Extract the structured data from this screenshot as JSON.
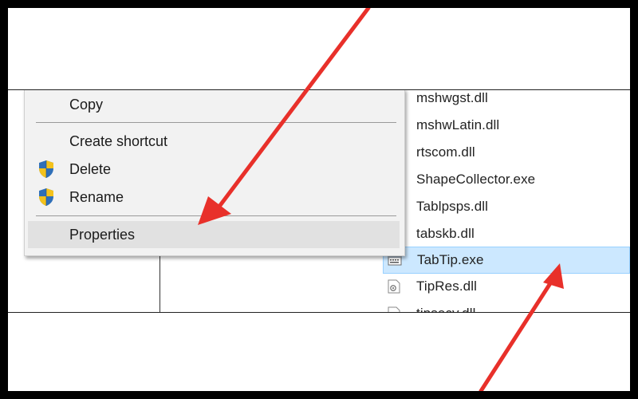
{
  "context_menu": {
    "items": [
      {
        "label": "Copy",
        "icon": "none"
      },
      {
        "label": "Create shortcut",
        "icon": "none"
      },
      {
        "label": "Delete",
        "icon": "uac-shield-icon"
      },
      {
        "label": "Rename",
        "icon": "uac-shield-icon"
      },
      {
        "label": "Properties",
        "icon": "none",
        "highlighted": true
      }
    ]
  },
  "file_list": {
    "items": [
      {
        "name": "mshwgst.dll"
      },
      {
        "name": "mshwLatin.dll"
      },
      {
        "name": "rtscom.dll"
      },
      {
        "name": "ShapeCollector.exe"
      },
      {
        "name": "Tablpsps.dll"
      },
      {
        "name": "tabskb.dll"
      },
      {
        "name": "TabTip.exe",
        "selected": true
      },
      {
        "name": "TipRes.dll"
      },
      {
        "name": "tipsecy.dll"
      }
    ]
  },
  "colors": {
    "annotation_arrow": "#e8302a",
    "selection_bg": "#cce8ff",
    "menu_bg": "#f2f2f2",
    "menu_highlight": "#e1e1e1"
  }
}
